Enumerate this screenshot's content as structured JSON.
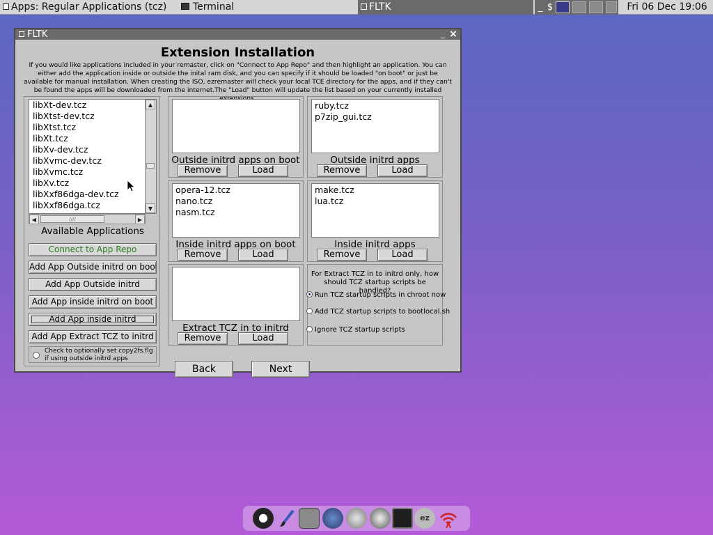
{
  "taskbar": {
    "apps_label": "Apps: Regular Applications (tcz)",
    "terminal_label": "Terminal",
    "fltk_label": "FLTK",
    "tray_underscore": "_",
    "tray_dollar": "$",
    "clock": "Fri 06 Dec 19:06"
  },
  "window": {
    "title": "FLTK",
    "minimize_glyph": "_",
    "close_glyph": "×",
    "heading": "Extension Installation",
    "intro": "If you would like applications included in your remaster, click on \"Connect to App Repo\" and then highlight an application.  You can either add the application inside or outside the inital ram disk, and you can specify if it should be loaded \"on boot\" or just be available for manual installation.  When creating the ISO, ezremaster will check your local TCE directory for the apps, and if they can't be found the apps will be downloaded from the internet.The \"Load\" button will update the list based on your currently installed extensions."
  },
  "available": {
    "items": [
      "libXt-dev.tcz",
      "libXtst-dev.tcz",
      "libXtst.tcz",
      "libXt.tcz",
      "libXv-dev.tcz",
      "libXvmc-dev.tcz",
      "libXvmc.tcz",
      "libXv.tcz",
      "libXxf86dga-dev.tcz",
      "libXxf86dga.tcz"
    ],
    "label": "Available Applications",
    "scroll_up": "▲",
    "scroll_down": "▼",
    "scroll_left": "◀",
    "scroll_right": "▶",
    "hthumb_grip": "////"
  },
  "left_buttons": {
    "connect": "Connect to App Repo",
    "add_out_boot": "Add App Outside initrd on boot",
    "add_out": "Add App Outside initrd",
    "add_in_boot": "Add App inside initrd on boot",
    "add_in": "Add App inside initrd",
    "add_extract": "Add App Extract TCZ to initrd",
    "copy_check_text": "Check to optionally set copy2fs.flg if using outside initrd apps"
  },
  "groups": {
    "outside_boot": {
      "label": "Outside initrd apps on boot",
      "items": []
    },
    "outside": {
      "label": "Outside initrd apps",
      "items": [
        "ruby.tcz",
        "p7zip_gui.tcz"
      ]
    },
    "inside_boot": {
      "label": "Inside initrd apps on boot",
      "items": [
        "opera-12.tcz",
        "nano.tcz",
        "nasm.tcz"
      ]
    },
    "inside": {
      "label": "Inside initrd apps",
      "items": [
        "make.tcz",
        "lua.tcz"
      ]
    },
    "extract": {
      "label": "Extract TCZ in to initrd",
      "items": []
    },
    "remove_label": "Remove",
    "load_label": "Load"
  },
  "startup": {
    "question": "For Extract TCZ in to initrd only, how should TCZ startup scripts be handled?",
    "options": [
      "Run TCZ startup scripts in chroot now",
      "Add TCZ startup scripts to bootlocal.sh",
      "Ignore TCZ startup scripts"
    ],
    "selected": 0
  },
  "nav": {
    "back": "Back",
    "next": "Next"
  },
  "dock": {
    "ezremaster_label": "ez"
  },
  "colors": {
    "window_bg": "#c6c6c6",
    "titlebar": "#6a6a6a",
    "connect_text": "#2a7a1e"
  }
}
